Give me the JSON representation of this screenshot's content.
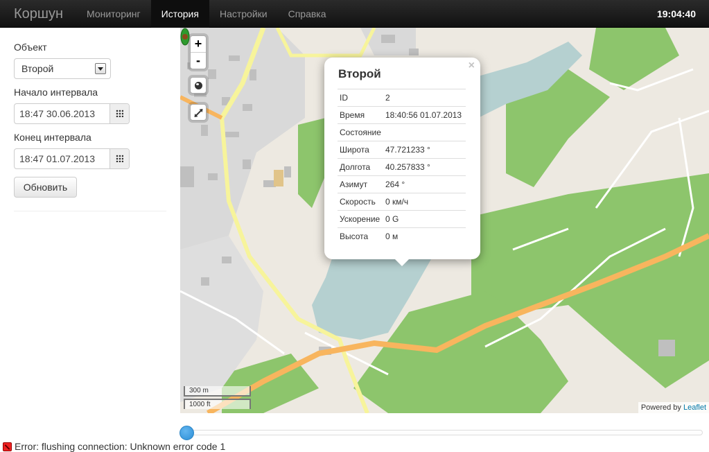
{
  "app": {
    "brand": "Коршун",
    "clock": "19:04:40"
  },
  "nav": {
    "items": [
      {
        "label": "Мониторинг",
        "active": false
      },
      {
        "label": "История",
        "active": true
      },
      {
        "label": "Настройки",
        "active": false
      },
      {
        "label": "Справка",
        "active": false
      }
    ]
  },
  "sidebar": {
    "object_label": "Объект",
    "object_value": "Второй",
    "start_label": "Начало интервала",
    "start_value": "18:47 30.06.2013",
    "end_label": "Конец интервала",
    "end_value": "18:47 01.07.2013",
    "refresh_label": "Обновить"
  },
  "map": {
    "zoom_in": "+",
    "zoom_out": "-",
    "scale_metric": "300 m",
    "scale_imperial": "1000 ft",
    "attribution_prefix": "Powered by ",
    "attribution_link": "Leaflet",
    "colors": {
      "water": "#b5d0d0",
      "forest": "#8dc56c",
      "road": "#f8b55e",
      "minor_road": "#f7f49b",
      "land": "#ede9e1"
    }
  },
  "popup": {
    "close": "×",
    "title": "Второй",
    "rows": [
      {
        "key": "ID",
        "value": "2"
      },
      {
        "key": "Время",
        "value": "18:40:56 01.07.2013"
      },
      {
        "key": "Состояние",
        "value": ""
      },
      {
        "key": "Широта",
        "value": "47.721233 °"
      },
      {
        "key": "Долгота",
        "value": "40.257833 °"
      },
      {
        "key": "Азимут",
        "value": "264 °"
      },
      {
        "key": "Скорость",
        "value": "0 км/ч"
      },
      {
        "key": "Ускорение",
        "value": "0 G"
      },
      {
        "key": "Высота",
        "value": "0 м"
      }
    ]
  },
  "slider": {
    "position": 0
  },
  "status": {
    "error": "Error: flushing connection: Unknown error code 1"
  }
}
